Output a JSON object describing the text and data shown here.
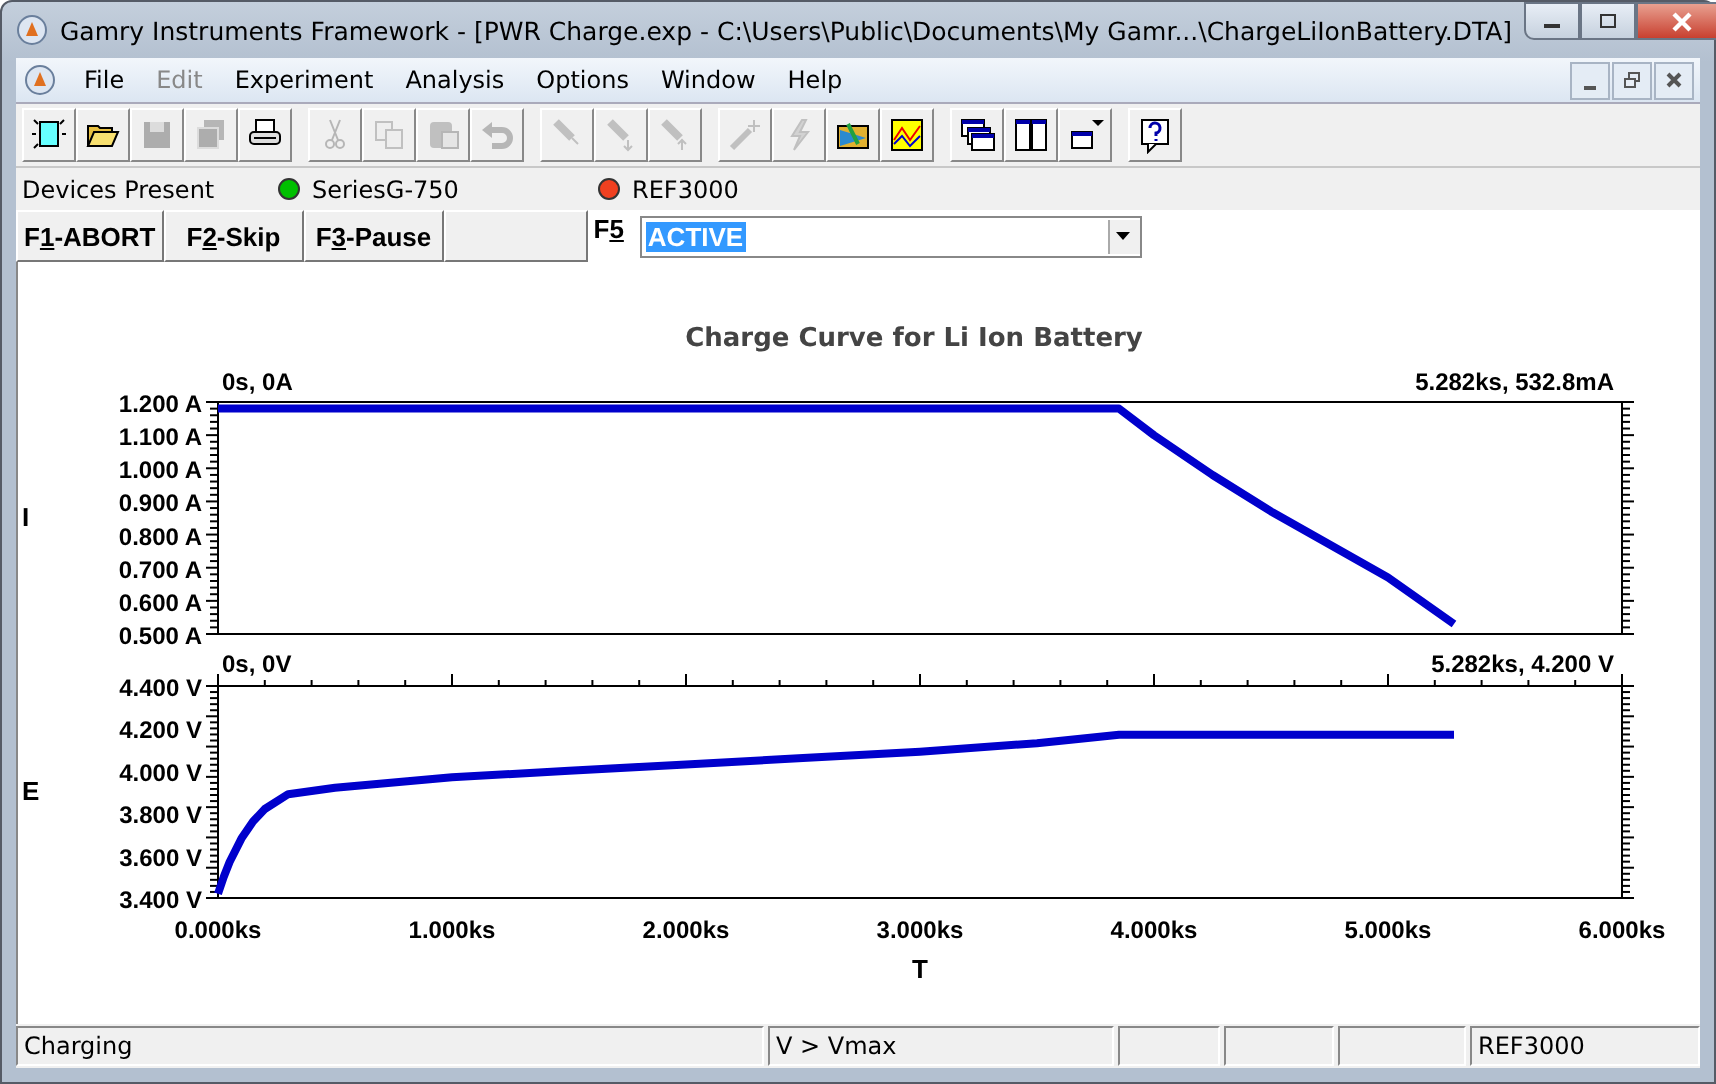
{
  "window": {
    "title": "Gamry Instruments Framework - [PWR Charge.exp - C:\\Users\\Public\\Documents\\My Gamr...\\ChargeLiIonBattery.DTA]"
  },
  "menu": [
    {
      "label": "File",
      "disabled": false
    },
    {
      "label": "Edit",
      "disabled": true
    },
    {
      "label": "Experiment",
      "disabled": false
    },
    {
      "label": "Analysis",
      "disabled": false
    },
    {
      "label": "Options",
      "disabled": false
    },
    {
      "label": "Window",
      "disabled": false
    },
    {
      "label": "Help",
      "disabled": false
    }
  ],
  "toolbar": [
    [
      {
        "disabled": false
      },
      {
        "disabled": false
      },
      {
        "disabled": true
      },
      {
        "disabled": true
      },
      {
        "disabled": false
      }
    ],
    [
      {
        "disabled": true
      },
      {
        "disabled": true
      },
      {
        "disabled": true
      },
      {
        "disabled": true
      }
    ],
    [
      {
        "disabled": true
      },
      {
        "disabled": true
      },
      {
        "disabled": true
      }
    ],
    [
      {
        "disabled": true
      },
      {
        "disabled": true
      },
      {
        "disabled": false
      },
      {
        "disabled": false
      }
    ],
    [
      {
        "disabled": false
      },
      {
        "disabled": false
      },
      {
        "disabled": false
      }
    ],
    [
      {
        "disabled": false
      }
    ]
  ],
  "devices": {
    "label": "Devices Present",
    "items": [
      {
        "name": "SeriesG-750",
        "color": "#00c000"
      },
      {
        "name": "REF3000",
        "color": "#f04020"
      }
    ]
  },
  "function_keys": [
    {
      "prefix": "F",
      "key": "1",
      "suffix": "-ABORT"
    },
    {
      "prefix": "F",
      "key": "2",
      "suffix": "-Skip"
    },
    {
      "prefix": "F",
      "key": "3",
      "suffix": "-Pause"
    }
  ],
  "f5": {
    "prefix": "F",
    "key": "5",
    "value": "ACTIVE",
    "highlighted": true
  },
  "charts": [
    {
      "cursor_left": "0s, 0A",
      "cursor_right": "5.282ks, 532.8mA",
      "chart_data": {
        "type": "line",
        "title": "Charge Curve for Li Ion Battery",
        "ylabel": "I",
        "x": [
          0,
          0.5,
          1,
          1.5,
          2,
          2.5,
          3,
          3.5,
          3.85,
          4,
          4.25,
          4.5,
          4.75,
          5,
          5.282
        ],
        "series": [
          {
            "color": "#0000cc",
            "values": [
              1.18,
              1.18,
              1.18,
              1.18,
              1.18,
              1.18,
              1.18,
              1.18,
              1.18,
              1.1,
              0.98,
              0.87,
              0.77,
              0.67,
              0.53
            ]
          }
        ],
        "xlim": [
          0,
          6
        ],
        "ylim": [
          0.5,
          1.2
        ],
        "yticks": [
          {
            "value": 1.2,
            "label": "1.200 A"
          },
          {
            "value": 1.1,
            "label": "1.100 A"
          },
          {
            "value": 1.0,
            "label": "1.000 A"
          },
          {
            "value": 0.9,
            "label": "0.900 A"
          },
          {
            "value": 0.8,
            "label": "0.800 A"
          },
          {
            "value": 0.7,
            "label": "0.700 A"
          },
          {
            "value": 0.6,
            "label": "0.600 A"
          },
          {
            "value": 0.5,
            "label": "0.500 A"
          }
        ]
      }
    },
    {
      "cursor_left": "0s, 0V",
      "cursor_right": "5.282ks, 4.200 V",
      "chart_data": {
        "type": "line",
        "xlabel": "T",
        "ylabel": "E",
        "x": [
          0,
          0.025,
          0.05,
          0.1,
          0.15,
          0.2,
          0.3,
          0.5,
          1,
          1.5,
          2,
          2.5,
          3,
          3.5,
          3.85,
          4,
          4.5,
          5,
          5.282
        ],
        "series": [
          {
            "color": "#0000cc",
            "values": [
              3.42,
              3.5,
              3.57,
              3.68,
              3.76,
              3.82,
              3.89,
              3.92,
              3.97,
              4.0,
              4.03,
              4.06,
              4.09,
              4.13,
              4.17,
              4.17,
              4.17,
              4.17,
              4.17
            ]
          }
        ],
        "xlim": [
          0,
          6
        ],
        "ylim": [
          3.4,
          4.4
        ],
        "xticks": [
          {
            "value": 0,
            "label": "0.000ks"
          },
          {
            "value": 1,
            "label": "1.000ks"
          },
          {
            "value": 2,
            "label": "2.000ks"
          },
          {
            "value": 3,
            "label": "3.000ks"
          },
          {
            "value": 4,
            "label": "4.000ks"
          },
          {
            "value": 5,
            "label": "5.000ks"
          },
          {
            "value": 6,
            "label": "6.000ks"
          }
        ],
        "yticks": [
          {
            "value": 4.4,
            "label": "4.400 V"
          },
          {
            "value": 4.2,
            "label": "4.200 V"
          },
          {
            "value": 4.0,
            "label": "4.000 V"
          },
          {
            "value": 3.8,
            "label": "3.800 V"
          },
          {
            "value": 3.6,
            "label": "3.600 V"
          },
          {
            "value": 3.4,
            "label": "3.400 V"
          }
        ]
      }
    }
  ],
  "status_bar": [
    {
      "kind": "text",
      "text": "Charging"
    },
    {
      "kind": "text",
      "text": "V > Vmax"
    },
    {
      "kind": "empty"
    },
    {
      "kind": "empty"
    },
    {
      "kind": "empty"
    },
    {
      "kind": "text",
      "text": "REF3000"
    }
  ]
}
